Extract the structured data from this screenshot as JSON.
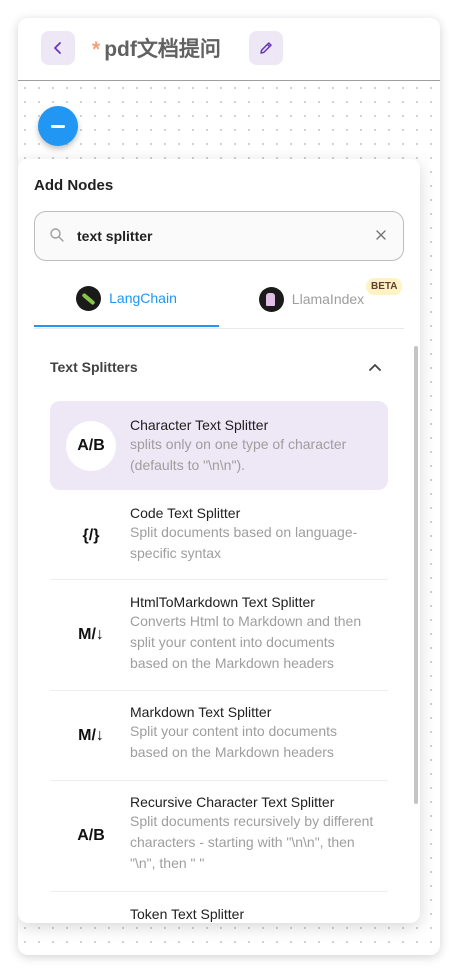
{
  "header": {
    "unsaved_marker": "*",
    "title": "pdf文档提问"
  },
  "panel": {
    "title": "Add Nodes",
    "search_value": "text splitter",
    "tabs": [
      {
        "label": "LangChain",
        "active": true
      },
      {
        "label": "LlamaIndex",
        "active": false,
        "badge": "BETA"
      }
    ],
    "section_title": "Text Splitters",
    "items": [
      {
        "title": "Character Text Splitter",
        "description": "splits only on one type of character (defaults to \"\\n\\n\").",
        "icon": "A/B",
        "selected": true
      },
      {
        "title": "Code Text Splitter",
        "description": "Split documents based on language-specific syntax",
        "icon": "{/}",
        "selected": false
      },
      {
        "title": "HtmlToMarkdown Text Splitter",
        "description": "Converts Html to Markdown and then split your content into documents based on the Markdown headers",
        "icon": "M/↓",
        "selected": false
      },
      {
        "title": "Markdown Text Splitter",
        "description": "Split your content into documents based on the Markdown headers",
        "icon": "M/↓",
        "selected": false
      },
      {
        "title": "Recursive Character Text Splitter",
        "description": "Split documents recursively by different characters - starting with \"\\n\\n\", then \"\\n\", then \" \"",
        "icon": "A/B",
        "selected": false
      },
      {
        "title": "Token Text Splitter",
        "description": "",
        "icon": "",
        "selected": false
      }
    ]
  },
  "colors": {
    "accent": "#2196f3",
    "selected_bg": "#ede7f6",
    "unsaved_marker": "#f4a07a",
    "beta_badge_bg": "#fff3c4"
  },
  "icons": [
    "back-arrow-icon",
    "pencil-icon",
    "minus-icon",
    "search-icon",
    "close-icon",
    "chevron-up-icon"
  ]
}
